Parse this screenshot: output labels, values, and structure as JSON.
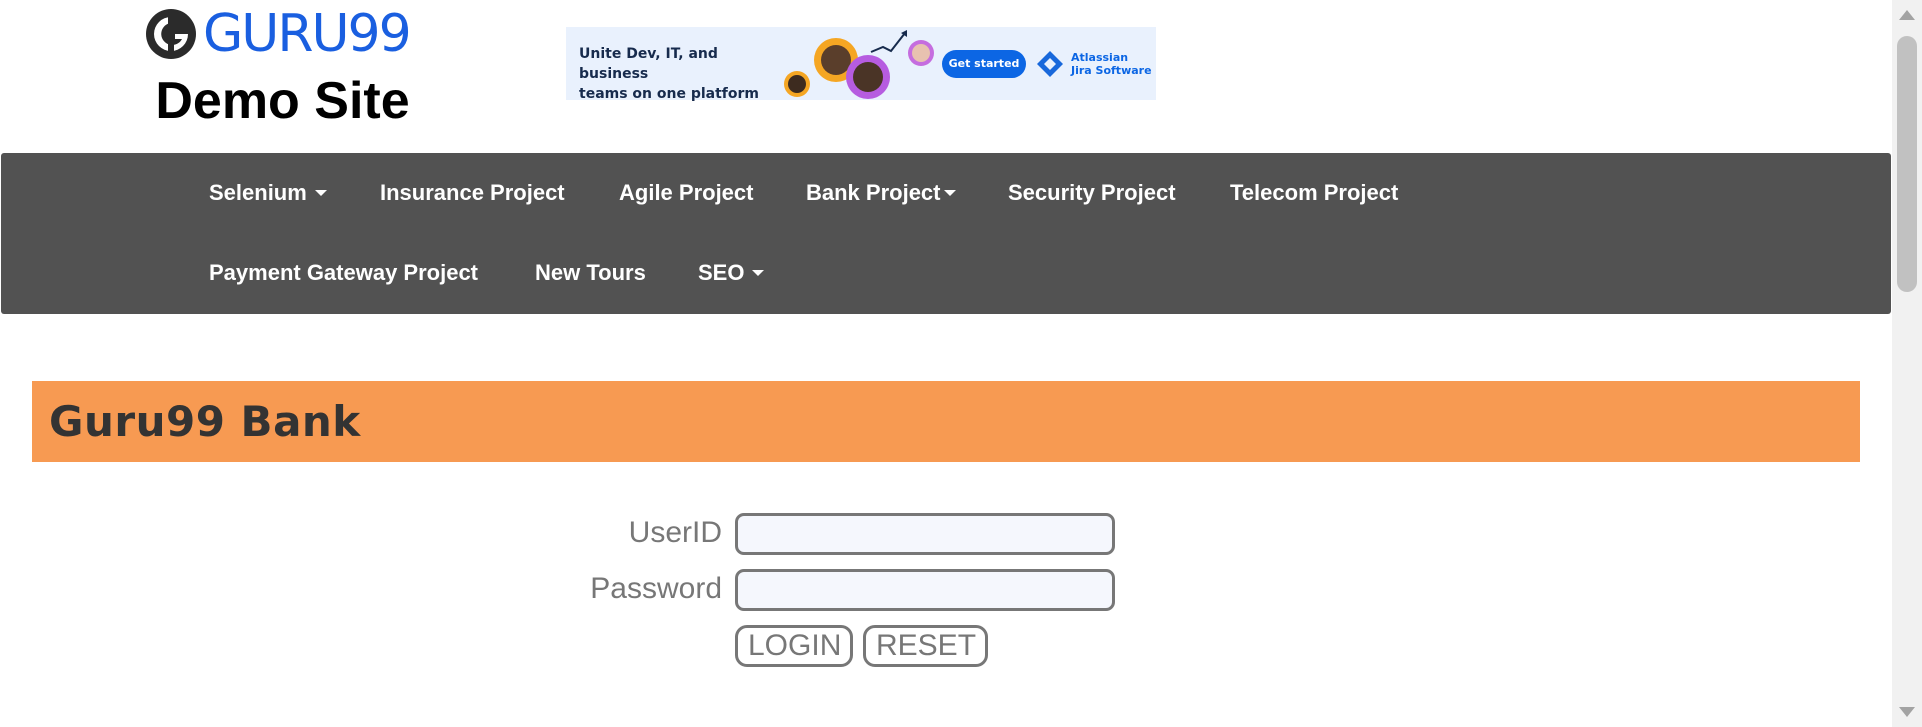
{
  "header": {
    "logo_text": "GURU99",
    "logo_subtitle": "Demo Site",
    "brand_color": "#1a5fe0"
  },
  "ad_banner": {
    "line1": "Unite Dev, IT, and business",
    "line2": "teams on one platform",
    "cta": "Get started",
    "brand_line1": "Atlassian",
    "brand_line2": "Jira Software",
    "background": "#e9f1fd",
    "accent": "#0c66e4"
  },
  "nav": {
    "background": "#525252",
    "items": [
      {
        "label": "Selenium",
        "dropdown": true
      },
      {
        "label": "Insurance Project",
        "dropdown": false
      },
      {
        "label": "Agile Project",
        "dropdown": false
      },
      {
        "label": "Bank Project",
        "dropdown": true
      },
      {
        "label": "Security Project",
        "dropdown": false
      },
      {
        "label": "Telecom Project",
        "dropdown": false
      },
      {
        "label": "Payment Gateway Project",
        "dropdown": false
      },
      {
        "label": "New Tours",
        "dropdown": false
      },
      {
        "label": "SEO",
        "dropdown": true
      }
    ]
  },
  "title_bar": {
    "title": "Guru99 Bank",
    "background": "#f79a52"
  },
  "login_form": {
    "userid_label": "UserID",
    "userid_value": "",
    "password_label": "Password",
    "password_value": "",
    "login_button": "LOGIN",
    "reset_button": "RESET"
  }
}
